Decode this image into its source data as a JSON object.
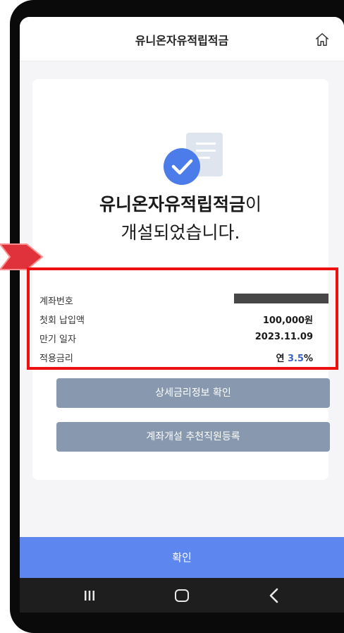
{
  "header": {
    "title": "유니온자유적립적금"
  },
  "result": {
    "headline_bold": "유니온자유적립적금",
    "headline_suffix": "이",
    "headline_line2": "개설되었습니다."
  },
  "info": [
    {
      "label": "계좌번호",
      "value": ""
    },
    {
      "label": "첫회 납입액",
      "value": "100,000원"
    },
    {
      "label": "만기 일자",
      "value": "2023.11.09"
    },
    {
      "label": "적용금리",
      "prefix": "연 ",
      "rate": "3.5",
      "suffix": "%"
    }
  ],
  "buttons": {
    "rate_detail": "상세금리정보 확인",
    "register_staff": "계좌개설 추천직원등록",
    "confirm": "확인"
  },
  "colors": {
    "accent_blue": "#5d86ef",
    "rate_blue": "#3c63c4",
    "gray_button": "#8798af",
    "highlight_red": "#ee1010"
  },
  "icons": [
    "home-icon",
    "check-document-icon",
    "recent-apps-icon",
    "home-nav-icon",
    "back-icon"
  ]
}
